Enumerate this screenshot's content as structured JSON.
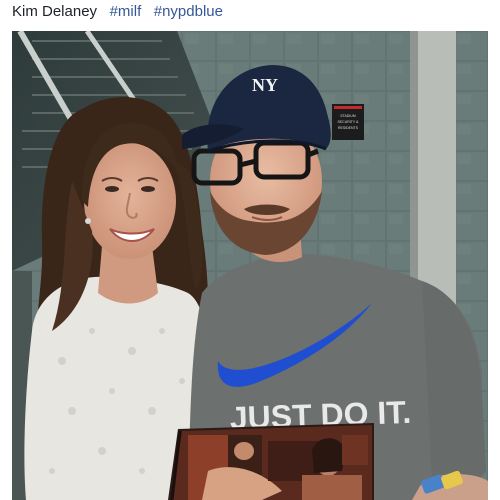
{
  "post": {
    "author": "Kim Delaney",
    "hashtags": [
      "#milf",
      "#nypdblue"
    ]
  },
  "photo": {
    "shirt_text": "JUST DO IT.",
    "cap_logo": "NY",
    "sign_lines": [
      "STADIUM",
      "SECURITY &",
      "RESIDENTS"
    ]
  },
  "colors": {
    "hashtag": "#365899",
    "caption_text": "#1d2129",
    "tile_wall": "#5d6f6c",
    "shirt": "#6b6e6d",
    "swoosh": "#1f4fd0",
    "cap": "#1b2740"
  },
  "icons": {
    "cap_logo": "yankees-logo-icon",
    "shirt_logo": "swoosh-icon"
  }
}
